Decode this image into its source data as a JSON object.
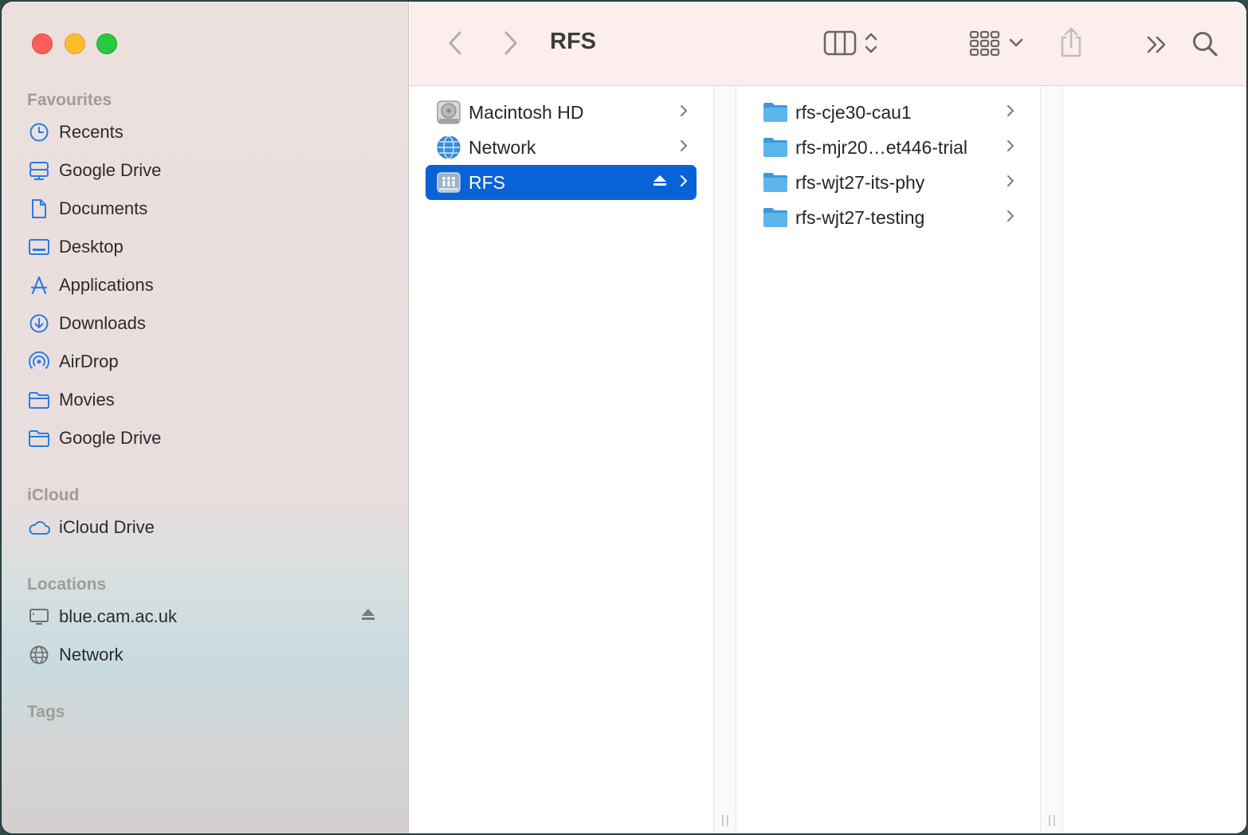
{
  "window": {
    "title": "RFS"
  },
  "sidebar": {
    "favourites_title": "Favourites",
    "favourites": [
      {
        "label": "Recents",
        "icon": "clock-icon"
      },
      {
        "label": "Google Drive",
        "icon": "drive-icon"
      },
      {
        "label": "Documents",
        "icon": "document-icon"
      },
      {
        "label": "Desktop",
        "icon": "desktop-icon"
      },
      {
        "label": "Applications",
        "icon": "applications-icon"
      },
      {
        "label": "Downloads",
        "icon": "download-icon"
      },
      {
        "label": "AirDrop",
        "icon": "airdrop-icon"
      },
      {
        "label": "Movies",
        "icon": "folder-icon"
      },
      {
        "label": "Google Drive",
        "icon": "folder-icon"
      }
    ],
    "icloud_title": "iCloud",
    "icloud": [
      {
        "label": "iCloud Drive",
        "icon": "cloud-icon"
      }
    ],
    "locations_title": "Locations",
    "locations": [
      {
        "label": "blue.cam.ac.uk",
        "icon": "server-icon",
        "ejectable": true
      },
      {
        "label": "Network",
        "icon": "globe-icon"
      }
    ],
    "tags_title": "Tags"
  },
  "column1": [
    {
      "label": "Macintosh HD",
      "icon": "hard-drive-icon"
    },
    {
      "label": "Network",
      "icon": "network-globe-icon"
    },
    {
      "label": "RFS",
      "icon": "network-share-icon",
      "selected": true,
      "ejectable": true
    }
  ],
  "column2": [
    {
      "label": "rfs-cje30-cau1",
      "icon": "folder-icon"
    },
    {
      "label": "rfs-mjr20…et446-trial",
      "icon": "folder-icon"
    },
    {
      "label": "rfs-wjt27-its-phy",
      "icon": "folder-icon"
    },
    {
      "label": "rfs-wjt27-testing",
      "icon": "folder-icon"
    }
  ],
  "colors": {
    "accent": "#0a63d6",
    "sidebar_icon": "#2a7be4",
    "folder": "#5cb6ec"
  }
}
